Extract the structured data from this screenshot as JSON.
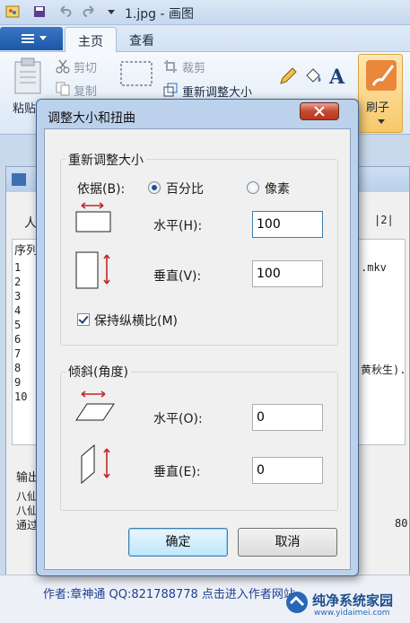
{
  "window": {
    "title": "1.jpg - 画图"
  },
  "ribbon": {
    "tabs": [
      "主页",
      "查看"
    ],
    "clipboard": {
      "paste": "粘贴",
      "cut": "剪切",
      "copy": "复制"
    },
    "image": {
      "crop": "裁剪",
      "resize": "重新调整大小"
    },
    "brush": "刷子"
  },
  "background": {
    "list_header": "序列",
    "tab_left": "人",
    "tab_right": "|2|",
    "row_numbers": [
      "1",
      "2",
      "3",
      "4",
      "5",
      "6",
      "7",
      "8",
      "9",
      "10"
    ],
    "row1_tail": ".mkv",
    "row8_tail": "黄秋生).",
    "output_label": "输出",
    "output_lines": [
      "八仙",
      "八仙",
      "通过"
    ],
    "output_num": "80",
    "footer": "作者:章神通    QQ:821788778    点击进入作者网站"
  },
  "dialog": {
    "title": "调整大小和扭曲",
    "resize_group": "重新调整大小",
    "by_label": "依据(B):",
    "percent": "百分比",
    "pixels": "像素",
    "horizontal": "水平(H):",
    "vertical": "垂直(V):",
    "h_value": "100",
    "v_value": "100",
    "keep_ratio": "保持纵横比(M)",
    "skew_group": "倾斜(角度)",
    "skew_h": "水平(O):",
    "skew_v": "垂直(E):",
    "skew_h_value": "0",
    "skew_v_value": "0",
    "ok": "确定",
    "cancel": "取消"
  },
  "watermark": {
    "name": "纯净系统家园",
    "url": "www.yidaimei.com"
  }
}
